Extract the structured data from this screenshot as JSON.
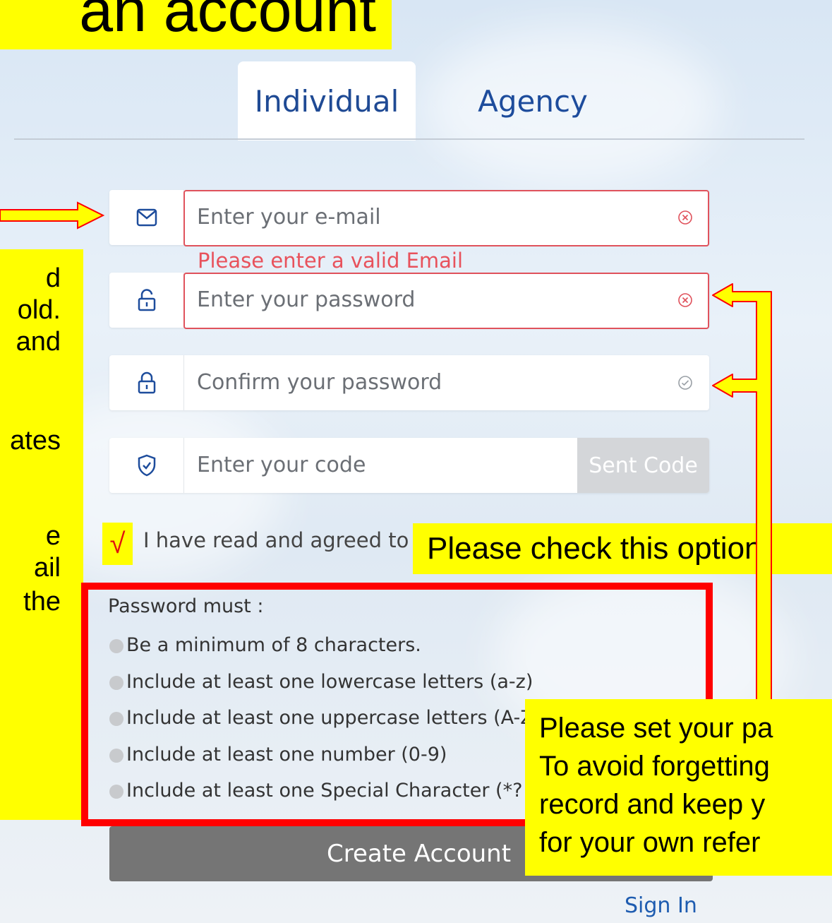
{
  "header": {
    "title": "an account"
  },
  "tabs": [
    {
      "label": "Individual",
      "active": true
    },
    {
      "label": "Agency",
      "active": false
    }
  ],
  "form": {
    "email": {
      "placeholder": "Enter your e-mail",
      "icon": "envelope-icon",
      "error": "Please enter a valid Email"
    },
    "password": {
      "placeholder": "Enter your password",
      "icon": "unlock-icon"
    },
    "confirm": {
      "placeholder": "Confirm your password",
      "icon": "lock-icon"
    },
    "code": {
      "placeholder": "Enter your code",
      "icon": "shield-check-icon",
      "send_label": "Sent Code"
    },
    "agree_text": "I have read and agreed to the",
    "check_mark": "√",
    "rules_title": "Password must :",
    "rules": [
      "Be a minimum of 8 characters.",
      "Include at least one lowercase letters (a-z)",
      "Include at least one uppercase letters (A-Z)",
      "Include at least one number (0-9)",
      "Include at least one Special Character (*?!&"
    ],
    "create_label": "Create Account",
    "sign_in_label": "Sign In"
  },
  "annotations": {
    "left_note_lines": [
      "d",
      "old.",
      "and",
      "ates",
      "e",
      "ail",
      "the"
    ],
    "check_callout": "Please check this option.",
    "password_callout": [
      "Please set your pa",
      "To avoid forgetting",
      "record and keep y",
      "for your own refer"
    ]
  },
  "colors": {
    "highlight": "#ffff00",
    "error": "#e0525c",
    "accent": "#1d4c9c",
    "frame": "#ff0000"
  }
}
